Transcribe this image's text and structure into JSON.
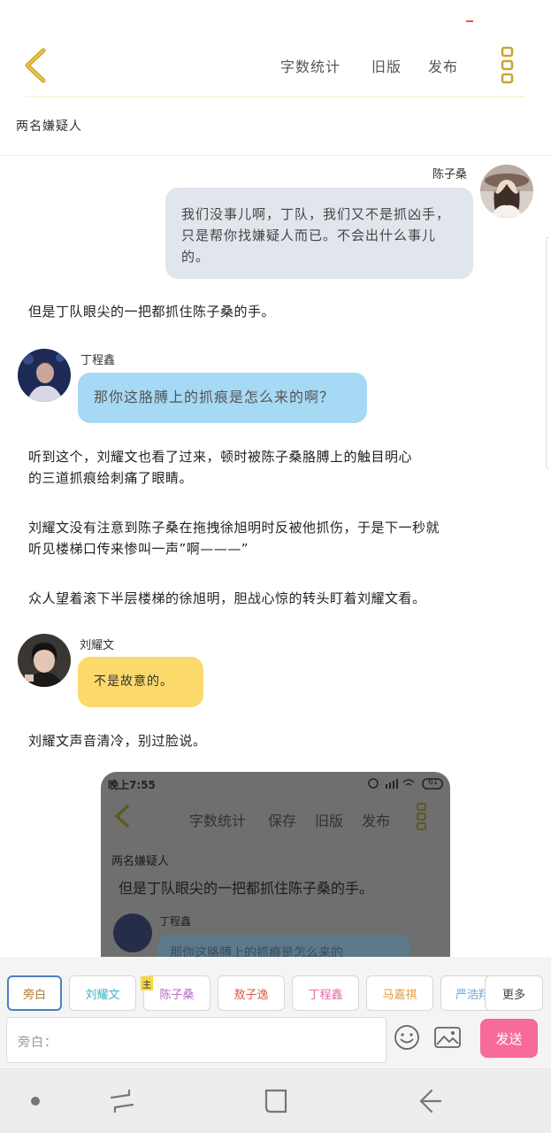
{
  "header": {
    "word_count_label": "字数统计",
    "old_version_label": "旧版",
    "publish_label": "发布"
  },
  "doc_title": "两名嫌疑人",
  "messages": {
    "m1": {
      "speaker": "陈子桑",
      "text": "我们没事儿啊，丁队，我们又不是抓凶手，只是帮你找嫌疑人而已。不会出什么事儿的。"
    },
    "n1": "但是丁队眼尖的一把都抓住陈子桑的手。",
    "m2": {
      "speaker": "丁程鑫",
      "text": "那你这胳膊上的抓痕是怎么来的啊？"
    },
    "n2a": "听到这个，刘耀文也看了过来，顿时被陈子桑胳膊上的触目明心",
    "n2b": "的三道抓痕给刺痛了眼睛。",
    "n3a": "刘耀文没有注意到陈子桑在拖拽徐旭明时反被他抓伤，于是下一秒就",
    "n3b": "听见楼梯口传来惨叫一声”啊———”",
    "n4": "众人望着滚下半层楼梯的徐旭明，胆战心惊的转头盯着刘耀文看。",
    "m3": {
      "speaker": "刘耀文",
      "text": "不是故意的。"
    },
    "n5": "刘耀文声音清冷，别过脸说。"
  },
  "embedded": {
    "time": "晚上7:55",
    "battery": "61",
    "word_count": "字数统计",
    "save": "保存",
    "old_version": "旧版",
    "publish": "发布",
    "doc_title": "两名嫌疑人",
    "line": "但是丁队眼尖的一把都抓住陈子桑的手。",
    "speaker": "丁程鑫",
    "bubble": "那你这胳膊上的抓痕是怎么来的"
  },
  "roles": [
    {
      "label": "旁白"
    },
    {
      "label": "刘耀文"
    },
    {
      "label": "陈子桑"
    },
    {
      "label": "敖子逸"
    },
    {
      "label": "丁程鑫"
    },
    {
      "label": "马嘉祺"
    },
    {
      "label": "严浩翔"
    }
  ],
  "roles_more": "更多",
  "main_badge": "主",
  "input": {
    "placeholder": "旁白："
  },
  "send_label": "发送",
  "colors": {
    "accent_yellow": "#d9b12c",
    "bubble_gray": "#e1e6ed",
    "bubble_blue": "#a6d9f4",
    "bubble_yellow": "#fcd96b",
    "send_pink": "#f66b98"
  }
}
